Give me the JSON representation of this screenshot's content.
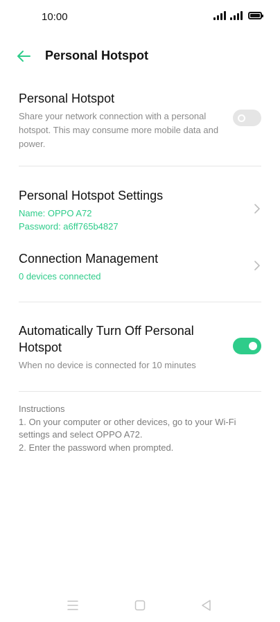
{
  "status_bar": {
    "time": "10:00"
  },
  "header": {
    "title": "Personal Hotspot"
  },
  "hotspot": {
    "title": "Personal Hotspot",
    "description": "Share your network connection with a personal hotspot. This may consume more mobile data and power.",
    "enabled": false
  },
  "settings": {
    "title": "Personal Hotspot Settings",
    "name_line": "Name: OPPO A72",
    "password_line": "Password: a6ff765b4827"
  },
  "connection": {
    "title": "Connection Management",
    "status": "0 devices connected"
  },
  "auto_off": {
    "title": "Automatically Turn Off Personal Hotspot",
    "description": "When no device is connected for 10 minutes",
    "enabled": true
  },
  "instructions": {
    "heading": "Instructions",
    "step1": "1. On your computer or other devices, go to your Wi-Fi settings and select OPPO A72.",
    "step2": "2. Enter the password when prompted."
  },
  "colors": {
    "accent": "#2ecc8a",
    "toggle_off": "#e5e5e5",
    "secondary_text": "#8a8a8a"
  },
  "icons": {
    "back": "arrow-left-icon",
    "chevron": "chevron-right-icon",
    "nav_menu": "menu-icon",
    "nav_home": "square-home-icon",
    "nav_back": "triangle-back-icon"
  }
}
